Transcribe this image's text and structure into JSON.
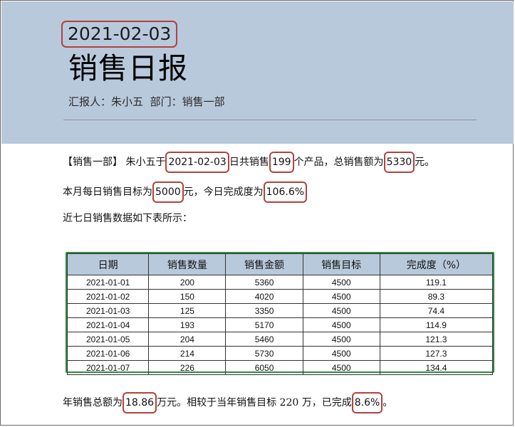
{
  "header": {
    "date": "2021-02-03",
    "title": "销售日报",
    "reporter_label": "汇报人：",
    "reporter_name": "朱小五",
    "department_label": "部门：",
    "department_name": "销售一部"
  },
  "summary": {
    "line1": {
      "dept_tag": "【销售一部】",
      "name": "朱小五于",
      "date": "2021-02-03",
      "text_a": "日共销售",
      "count": "199",
      "text_b": "个产品，总销售额为",
      "amount": "5330",
      "text_c": "元。"
    },
    "line2": {
      "text_a": "本月每日销售目标为",
      "target": "5000",
      "text_b": "元，今日完成度为",
      "completion": "106.6%"
    },
    "line3": "近七日销售数据如下表所示："
  },
  "table": {
    "headers": [
      "日期",
      "销售数量",
      "销售金额",
      "销售目标",
      "完成度（%）"
    ],
    "rows": [
      [
        "2021-01-01",
        "200",
        "5360",
        "4500",
        "119.1"
      ],
      [
        "2021-01-02",
        "150",
        "4020",
        "4500",
        "89.3"
      ],
      [
        "2021-01-03",
        "125",
        "3350",
        "4500",
        "74.4"
      ],
      [
        "2021-01-04",
        "193",
        "5170",
        "4500",
        "114.9"
      ],
      [
        "2021-01-05",
        "204",
        "5460",
        "4500",
        "121.3"
      ],
      [
        "2021-01-06",
        "214",
        "5730",
        "4500",
        "127.3"
      ],
      [
        "2021-01-07",
        "226",
        "6050",
        "4500",
        "134.4"
      ]
    ]
  },
  "footer": {
    "text_a": "年销售总额为",
    "total": "18.86",
    "text_b": "万元。相较于当年销售目标 220 万，已完成",
    "percent": "8.6%",
    "text_c": "。"
  },
  "colors": {
    "header_bg": "#b9c9dc",
    "highlight_border": "#b3413b",
    "table_border": "#2e8b3e"
  }
}
